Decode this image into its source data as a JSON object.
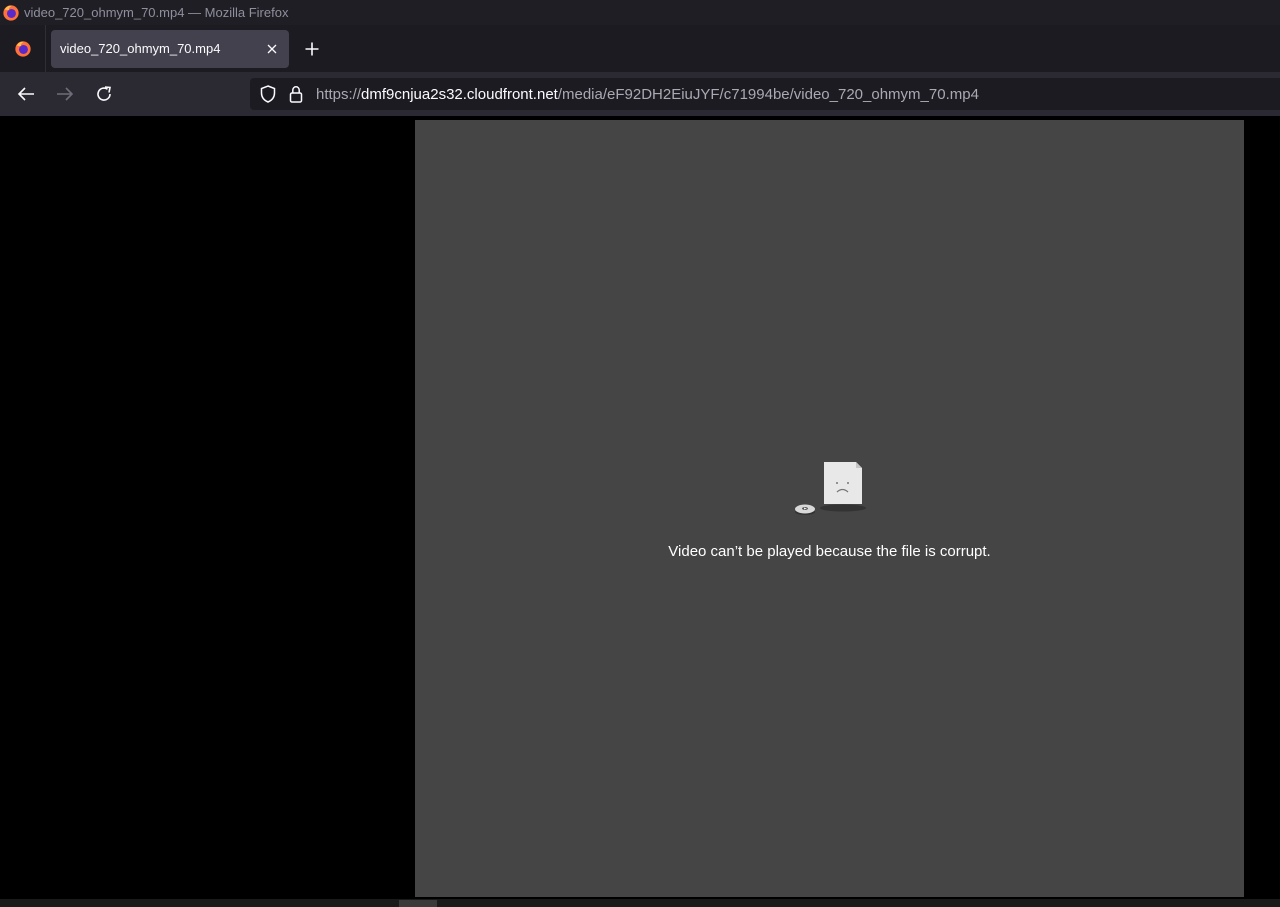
{
  "window": {
    "title": "video_720_ohmym_70.mp4 — Mozilla Firefox",
    "app_icon": "firefox-logo-icon"
  },
  "tabs": [
    {
      "label": "video_720_ohmym_70.mp4",
      "close_icon": "close-icon",
      "active": true
    }
  ],
  "toolbar": {
    "back_icon": "arrow-left-icon",
    "forward_icon": "arrow-right-icon",
    "reload_icon": "reload-icon",
    "new_tab_icon": "plus-icon"
  },
  "urlbar": {
    "scheme": "https://",
    "host": "dmf9cnjua2s32.cloudfront.net",
    "path": "/media/eF92DH2EiuJYF/c71994be/video_720_ohmym_70.mp4",
    "shield_icon": "tracking-protection-shield-icon",
    "lock_icon": "lock-icon"
  },
  "video": {
    "error_icon": "corrupt-video-file-icon",
    "error_message": "Video can’t be played because the file is corrupt."
  },
  "colors": {
    "titlebar_bg": "#1f1e25",
    "tabstrip_bg": "#1c1b22",
    "active_tab_bg": "#42414d",
    "navbar_bg": "#2b2a33",
    "urlbar_bg": "#1c1b22",
    "video_bg": "#454545",
    "page_bg": "#000000"
  }
}
